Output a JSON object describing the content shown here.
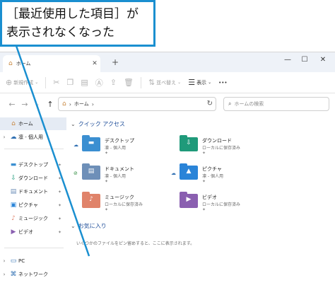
{
  "callout": {
    "line1": "［最近使用した項目］が",
    "line2": "表示されなくなった"
  },
  "titlebar": {
    "tab_label": "ホーム",
    "tab_icon": "home-icon",
    "tab_close": "✕",
    "tab_add": "+",
    "minimize": "—",
    "maximize": "☐",
    "close": "✕"
  },
  "commandbar": {
    "new_label": "新規作成",
    "sort_label": "並べ替え",
    "view_label": "表示",
    "more_label": "•••"
  },
  "address": {
    "location": "ホーム",
    "search_placeholder": "ホームの検索"
  },
  "sidebar": {
    "home": "ホーム",
    "onedrive": "凛 - 個人用",
    "pinned": [
      {
        "label": "デスクトップ",
        "icon": "desktop-icon"
      },
      {
        "label": "ダウンロード",
        "icon": "download-icon"
      },
      {
        "label": "ドキュメント",
        "icon": "documents-icon"
      },
      {
        "label": "ピクチャ",
        "icon": "pictures-icon"
      },
      {
        "label": "ミュージック",
        "icon": "music-icon"
      },
      {
        "label": "ビデオ",
        "icon": "videos-icon"
      }
    ],
    "pc": "PC",
    "network": "ネットワーク"
  },
  "quick_access": {
    "heading": "クイック アクセス",
    "items": [
      {
        "name": "デスクトップ",
        "sub": "凛 - 個人用",
        "color": "#3b8fd1"
      },
      {
        "name": "ダウンロード",
        "sub": "ローカルに保存済み",
        "color": "#1f9a7a"
      },
      {
        "name": "ドキュメント",
        "sub": "凛 - 個人用",
        "color": "#6e8fb8"
      },
      {
        "name": "ピクチャ",
        "sub": "凛 - 個人用",
        "color": "#2a84d8"
      },
      {
        "name": "ミュージック",
        "sub": "ローカルに保存済み",
        "color": "#e0836a"
      },
      {
        "name": "ビデオ",
        "sub": "ローカルに保存済み",
        "color": "#8a5fb0"
      }
    ]
  },
  "favorites": {
    "heading": "お気に入り",
    "empty_text": "いくつかのファイルをピン留めすると、ここに表示されます。"
  },
  "colors": {
    "callout_border": "#1a8fd0",
    "pointer": "#1a8fd0",
    "accent": "#1f4e99"
  }
}
